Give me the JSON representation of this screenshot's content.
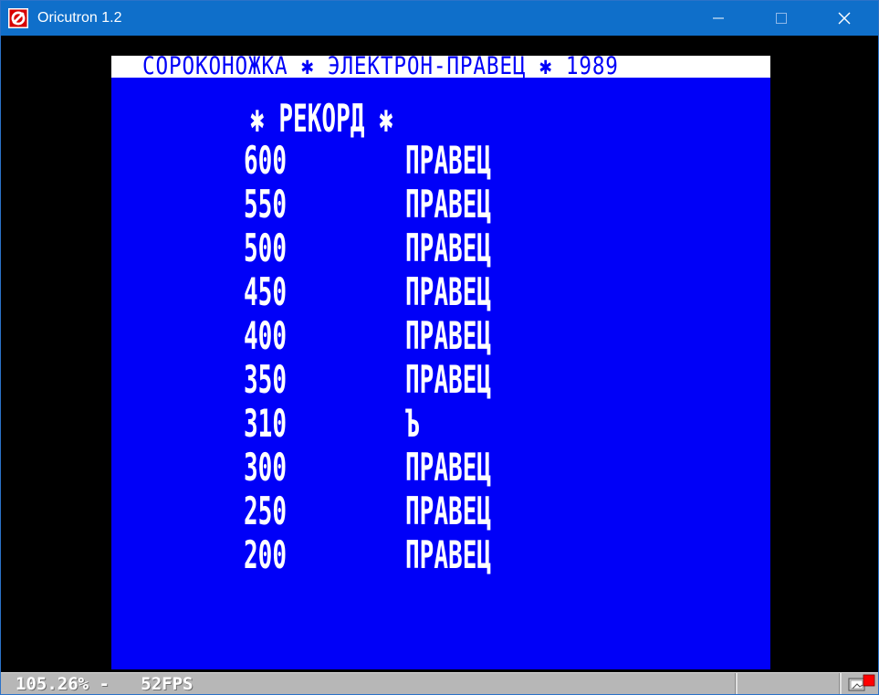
{
  "window": {
    "title": "Oricutron 1.2"
  },
  "icons": {
    "app": "oricutron-logo-icon",
    "minimize": "minimize-icon",
    "maximize": "maximize-icon",
    "close": "close-icon",
    "status": "screen-capture-icon"
  },
  "screen": {
    "header": "СОРОКОНОЖКА ✱ ЭЛЕКТРОН-ПРАВЕЦ ✱ 1989",
    "records_heading": "✱  РЕКОРД   ✱",
    "scores": [
      {
        "score": "600",
        "name": "ПРАВЕЦ"
      },
      {
        "score": "550",
        "name": "ПРАВЕЦ"
      },
      {
        "score": "500",
        "name": "ПРАВЕЦ"
      },
      {
        "score": "450",
        "name": "ПРАВЕЦ"
      },
      {
        "score": "400",
        "name": "ПРАВЕЦ"
      },
      {
        "score": "350",
        "name": "ПРАВЕЦ"
      },
      {
        "score": "310",
        "name": "Ъ"
      },
      {
        "score": "300",
        "name": "ПРАВЕЦ"
      },
      {
        "score": "250",
        "name": "ПРАВЕЦ"
      },
      {
        "score": "200",
        "name": "ПРАВЕЦ"
      }
    ]
  },
  "status": {
    "text": "105.26% -   52FPS"
  },
  "colors": {
    "titlebar": "#0f6fca",
    "screen": "#0000f8",
    "text": "#ffffff",
    "statusbar": "#b7b7b7",
    "status_red": "#ff0000"
  }
}
